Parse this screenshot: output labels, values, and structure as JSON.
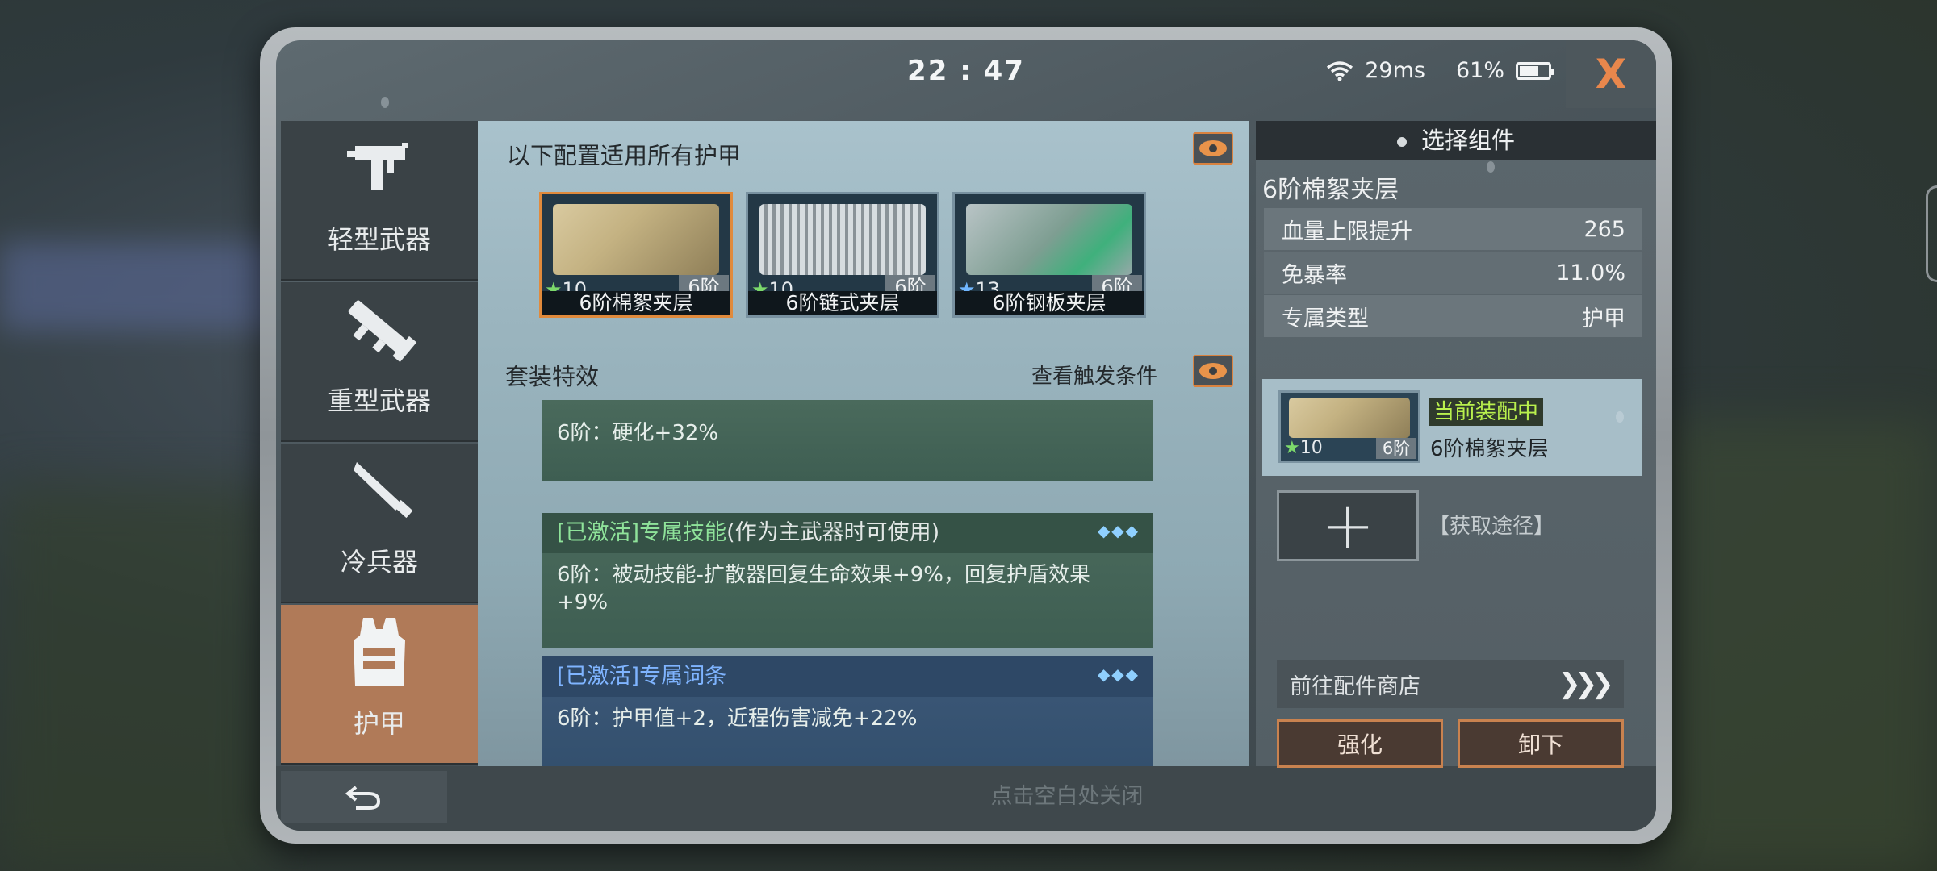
{
  "status": {
    "time": "22 : 47",
    "ping": "29ms",
    "battery": "61%"
  },
  "close_label": "X",
  "tabs": [
    {
      "label": "轻型武器",
      "icon": "smg-icon"
    },
    {
      "label": "重型武器",
      "icon": "launcher-icon"
    },
    {
      "label": "冷兵器",
      "icon": "knife-icon"
    },
    {
      "label": "护甲",
      "icon": "vest-icon"
    }
  ],
  "close_hint": "点击空白处关闭",
  "middle": {
    "title": "以下配置适用所有护甲",
    "cards": [
      {
        "name": "6阶棉絮夹层",
        "stars": "10",
        "tier": "6阶",
        "star_color": "#7cd96b"
      },
      {
        "name": "6阶链式夹层",
        "stars": "10",
        "tier": "6阶",
        "star_color": "#7cd96b"
      },
      {
        "name": "6阶钢板夹层",
        "stars": "13",
        "tier": "6阶",
        "star_color": "#6fb6ff"
      }
    ],
    "set_title": "套装特效",
    "trigger_link": "查看触发条件",
    "effects": [
      {
        "header": "",
        "body": "6阶：硬化+32%"
      },
      {
        "header": "[已激活]专属技能",
        "note": "(作为主武器时可使用)",
        "body": "6阶：被动技能-扩散器回复生命效果+9%，回复护盾效果+9%"
      },
      {
        "header": "[已激活]专属词条",
        "body": "6阶：护甲值+2，近程伤害减免+22%"
      }
    ]
  },
  "right": {
    "header": "选择组件",
    "component_name": "6阶棉絮夹层",
    "stats": [
      {
        "label": "血量上限提升",
        "value": "265"
      },
      {
        "label": "免暴率",
        "value": "11.0%"
      },
      {
        "label": "专属类型",
        "value": "护甲"
      }
    ],
    "equipped": {
      "badge": "当前装配中",
      "name": "6阶棉絮夹层",
      "stars": "10",
      "tier": "6阶"
    },
    "add_label": "+",
    "get_way": "【获取途径】",
    "shop_link": "前往配件商店",
    "shop_arrows": "❯❯❯",
    "buttons": {
      "enhance": "强化",
      "unequip": "卸下"
    }
  },
  "colors": {
    "accent": "#e08a3c",
    "active_tab": "#b07a58",
    "green_text": "#8fe39a",
    "blue_text": "#7fb4ff"
  }
}
